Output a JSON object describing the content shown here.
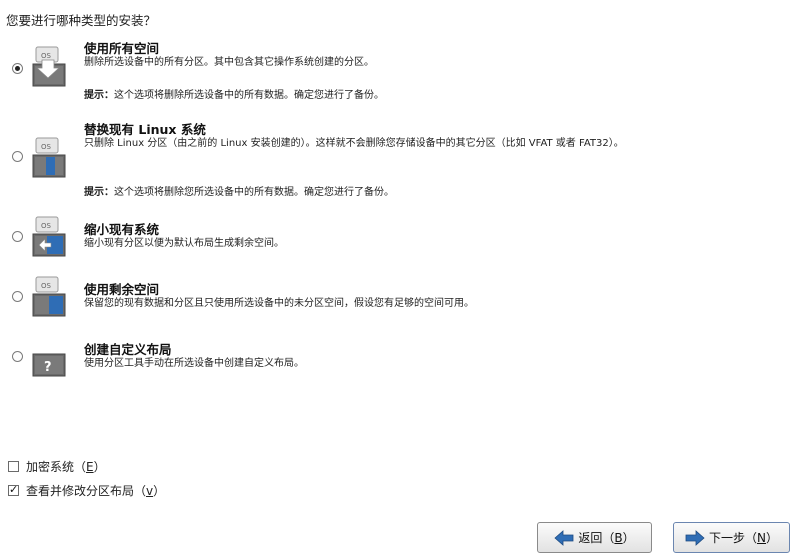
{
  "question": "您要进行哪种类型的安装？",
  "options": [
    {
      "title": "使用所有空间",
      "desc": "删除所选设备中的所有分区。其中包含其它操作系统创建的分区。",
      "tip_label": "提示：",
      "tip_text": "这个选项将删除所选设备中的所有数据。确定您进行了备份。",
      "selected": true,
      "icon": "disk-use-all-icon"
    },
    {
      "title": "替换现有 Linux 系统",
      "desc": "只删除 Linux 分区（由之前的 Linux 安装创建的）。这样就不会删除您存储设备中的其它分区（比如 VFAT 或者 FAT32）。",
      "tip_label": "提示：",
      "tip_text": "这个选项将删除您所选设备中的所有数据。确定您进行了备份。",
      "selected": false,
      "icon": "disk-replace-linux-icon"
    },
    {
      "title": "缩小现有系统",
      "desc": "缩小现有分区以便为默认布局生成剩余空间。",
      "selected": false,
      "icon": "disk-shrink-icon"
    },
    {
      "title": "使用剩余空间",
      "desc": "保留您的现有数据和分区且只使用所选设备中的未分区空间，假设您有足够的空间可用。",
      "selected": false,
      "icon": "disk-free-space-icon"
    },
    {
      "title": "创建自定义布局",
      "desc": "使用分区工具手动在所选设备中创建自定义布局。",
      "selected": false,
      "icon": "disk-custom-layout-icon"
    }
  ],
  "checkboxes": [
    {
      "label_pre": "加密系统（",
      "accel": "E",
      "label_post": "）",
      "checked": false
    },
    {
      "label_pre": "查看并修改分区布局（",
      "accel": "v",
      "label_post": "）",
      "checked": true
    }
  ],
  "buttons": {
    "back": {
      "pre": "返回（",
      "accel": "B",
      "post": "）"
    },
    "next": {
      "pre": "下一步（",
      "accel": "N",
      "post": "）"
    }
  },
  "colors": {
    "icon_blue": "#2f6db5",
    "button_border": "#8a8a8a"
  }
}
